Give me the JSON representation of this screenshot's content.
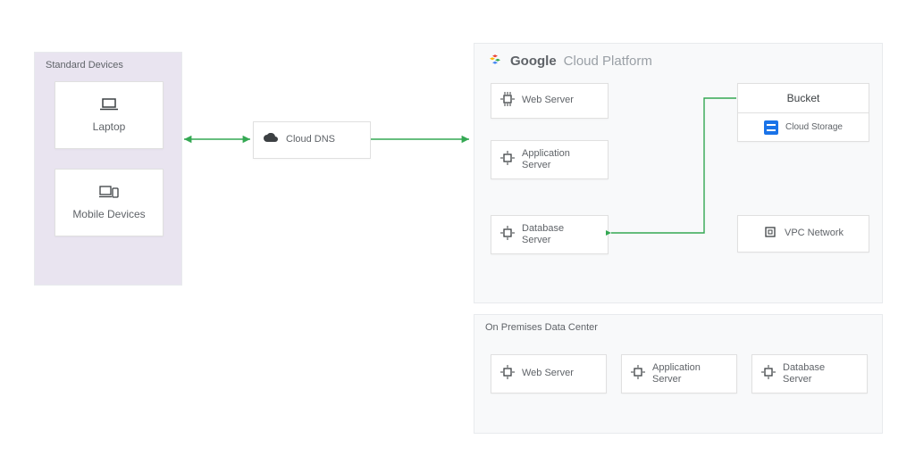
{
  "devices": {
    "title": "Standard Devices",
    "laptop_label": "Laptop",
    "mobile_label": "Mobile Devices"
  },
  "cloud_dns": {
    "label": "Cloud DNS"
  },
  "gcp": {
    "brand1": "Google",
    "brand2": "Cloud Platform",
    "web_label": "Web Server",
    "app_label": "Application\nServer",
    "db_label": "Database\nServer",
    "bucket_label": "Bucket",
    "storage_label": "Cloud Storage",
    "vpc_label": "VPC Network"
  },
  "onprem": {
    "title": "On Premises Data Center",
    "web_label": "Web Server",
    "app_label": "Application\nServer",
    "db_label": "Database\nServer"
  },
  "colors": {
    "arrow": "#34a853"
  }
}
